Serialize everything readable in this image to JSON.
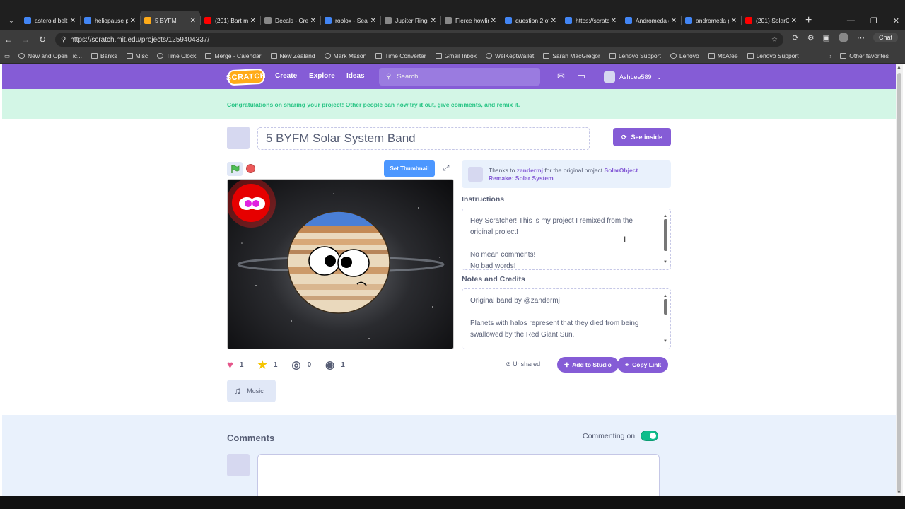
{
  "browser": {
    "tabs": [
      {
        "label": "asteroid belt",
        "color": "#4285f4"
      },
      {
        "label": "heliopause p",
        "color": "#4285f4"
      },
      {
        "label": "5 BYFM",
        "color": "#ffab19",
        "active": true
      },
      {
        "label": "(201) Bart mu",
        "color": "#ff0000"
      },
      {
        "label": "Decals - Crea",
        "color": "#888888"
      },
      {
        "label": "roblox - Sear",
        "color": "#4285f4"
      },
      {
        "label": "Jupiter Rings",
        "color": "#888888"
      },
      {
        "label": "Fierce howlin",
        "color": "#888888"
      },
      {
        "label": "question 2 of",
        "color": "#4285f4"
      },
      {
        "label": "https://scratc",
        "color": "#4285f4"
      },
      {
        "label": "Andromeda g",
        "color": "#4285f4"
      },
      {
        "label": "andromeda g",
        "color": "#4285f4"
      },
      {
        "label": "(201) SolarOb",
        "color": "#ff0000"
      }
    ],
    "url": "https://scratch.mit.edu/projects/1259404337/",
    "chat_label": "Chat",
    "bookmarks": [
      "New and Open Tic...",
      "Banks",
      "Misc",
      "Time Clock",
      "Merge - Calendar",
      "New Zealand",
      "Mark Mason",
      "Time Converter",
      "Gmail Inbox",
      "WelKeptWallet",
      "Sarah MacGregor",
      "Lenovo Support",
      "Lenovo",
      "McAfee",
      "Lenovo Support"
    ],
    "other_favorites": "Other favorites"
  },
  "nav": {
    "logo": "SCRATCH",
    "create": "Create",
    "explore": "Explore",
    "ideas": "Ideas",
    "search_placeholder": "Search",
    "username": "AshLee589"
  },
  "banner": "Congratulations on sharing your project! Other people can now try it out, give comments, and remix it.",
  "project": {
    "title": "5 BYFM Solar System Band",
    "see_inside": "See inside",
    "set_thumbnail": "Set Thumbnail",
    "credit_prefix": "Thanks to",
    "credit_user": "zandermj",
    "credit_mid": "for the original project",
    "credit_project": "SolarObject Remake: Solar System",
    "credit_end": ".",
    "instructions_heading": "Instructions",
    "instructions_lines": [
      "Hey Scratcher! This is my project I remixed from the original project!",
      "",
      "No mean comments!",
      "No bad words!"
    ],
    "notes_heading": "Notes and Credits",
    "notes_lines": [
      "Original band by @zandermj",
      "",
      "Planets with halos represent that they died from being swallowed by the Red Giant Sun."
    ],
    "loves": "1",
    "favorites": "1",
    "remixes": "0",
    "views": "1",
    "status": "Unshared",
    "add_to_studio": "Add to Studio",
    "copy_link": "Copy Link",
    "tag": "Music"
  },
  "comments": {
    "heading": "Comments",
    "commenting": "Commenting on",
    "commenting_enabled": true
  }
}
